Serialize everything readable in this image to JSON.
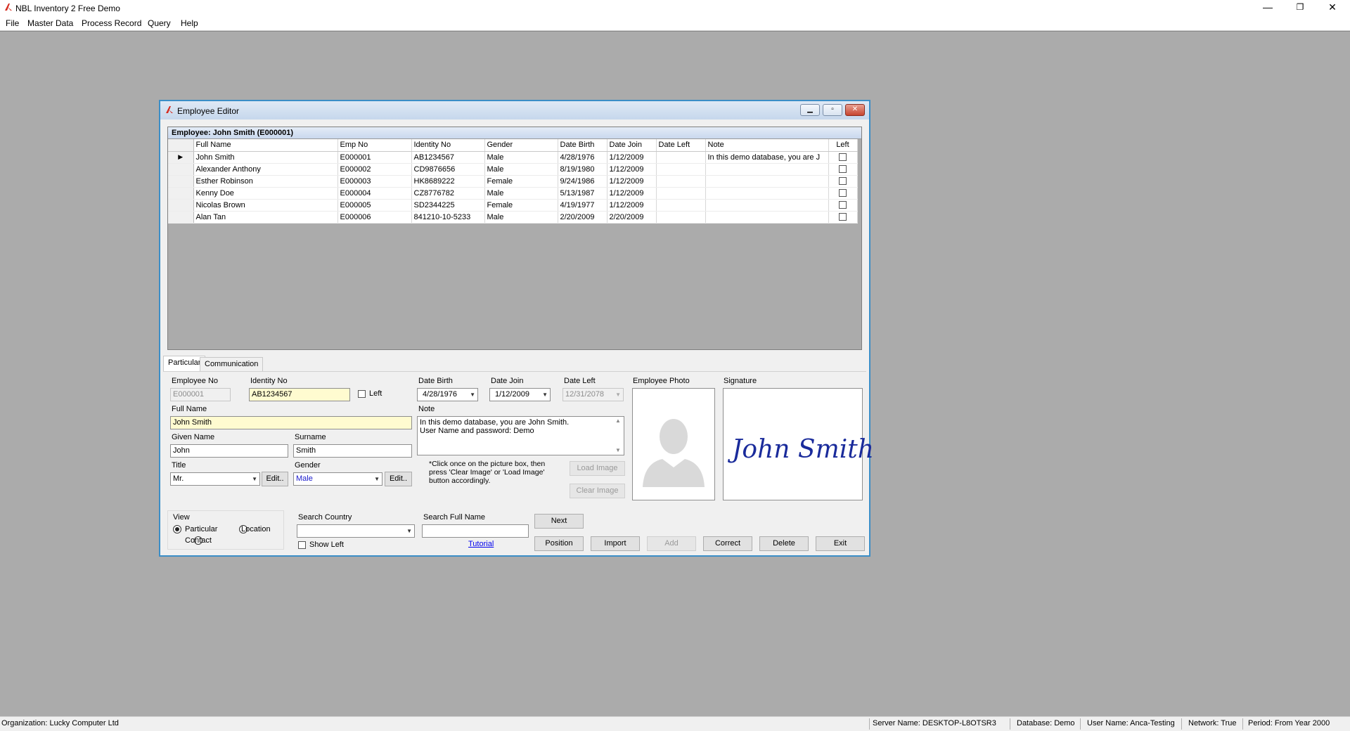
{
  "app": {
    "title": "NBL Inventory 2 Free Demo",
    "menu": [
      "File",
      "Master Data",
      "Process Record",
      "Query",
      "Help"
    ],
    "window_buttons": [
      "—",
      "❐",
      "✕"
    ]
  },
  "child": {
    "title": "Employee Editor",
    "grid_caption": "Employee: John Smith (E000001)",
    "columns": [
      "Full Name",
      "Emp No",
      "Identity No",
      "Gender",
      "Date Birth",
      "Date Join",
      "Date Left",
      "Note",
      "Left"
    ],
    "rows": [
      {
        "full_name": "John Smith",
        "emp_no": "E000001",
        "identity_no": "AB1234567",
        "gender": "Male",
        "date_birth": "4/28/1976",
        "date_join": "1/12/2009",
        "date_left": "",
        "note": "In this demo database, you are J",
        "current": "▶"
      },
      {
        "full_name": "Alexander Anthony",
        "emp_no": "E000002",
        "identity_no": "CD9876656",
        "gender": "Male",
        "date_birth": "8/19/1980",
        "date_join": "1/12/2009",
        "date_left": "",
        "note": "",
        "current": ""
      },
      {
        "full_name": "Esther Robinson",
        "emp_no": "E000003",
        "identity_no": "HK8689222",
        "gender": "Female",
        "date_birth": "9/24/1986",
        "date_join": "1/12/2009",
        "date_left": "",
        "note": "",
        "current": ""
      },
      {
        "full_name": "Kenny Doe",
        "emp_no": "E000004",
        "identity_no": "CZ8776782",
        "gender": "Male",
        "date_birth": "5/13/1987",
        "date_join": "1/12/2009",
        "date_left": "",
        "note": "",
        "current": ""
      },
      {
        "full_name": "Nicolas Brown",
        "emp_no": "E000005",
        "identity_no": "SD2344225",
        "gender": "Female",
        "date_birth": "4/19/1977",
        "date_join": "1/12/2009",
        "date_left": "",
        "note": "",
        "current": ""
      },
      {
        "full_name": "Alan Tan",
        "emp_no": "E000006",
        "identity_no": "841210-10-5233",
        "gender": "Male",
        "date_birth": "2/20/2009",
        "date_join": "2/20/2009",
        "date_left": "",
        "note": "",
        "current": ""
      }
    ],
    "tabs": [
      "Particular",
      "Communication"
    ],
    "form": {
      "employee_no_label": "Employee No",
      "employee_no": "E000001",
      "identity_no_label": "Identity No",
      "identity_no": "AB1234567",
      "left_label": "Left",
      "date_birth_label": "Date Birth",
      "date_birth": "4/28/1976",
      "date_join_label": "Date Join",
      "date_join": "1/12/2009",
      "date_left_label": "Date Left",
      "date_left": "12/31/2078",
      "employee_photo_label": "Employee Photo",
      "signature_label": "Signature",
      "signature_text": "John Smith",
      "full_name_label": "Full Name",
      "full_name": "John Smith",
      "note_label": "Note",
      "note": "In this demo database, you are John Smith.\nUser Name and password: Demo",
      "given_name_label": "Given Name",
      "given_name": "John",
      "surname_label": "Surname",
      "surname": "Smith",
      "title_label": "Title",
      "title": "Mr.",
      "gender_label": "Gender",
      "gender": "Male",
      "edit_label": "Edit..",
      "hint": "*Click once on the picture box, then press 'Clear Image' or 'Load Image' button accordingly.",
      "load_image": "Load Image",
      "clear_image": "Clear Image"
    },
    "bottom": {
      "view_label": "View",
      "view_particular": "Particular",
      "view_location": "Location",
      "view_contact": "Contact",
      "search_country_label": "Search Country",
      "search_country": "",
      "show_left_label": "Show Left",
      "search_full_name_label": "Search Full Name",
      "search_full_name": "",
      "tutorial": "Tutorial",
      "next": "Next",
      "position": "Position",
      "import": "Import",
      "add": "Add",
      "correct": "Correct",
      "delete": "Delete",
      "exit": "Exit"
    }
  },
  "status": {
    "organization": "Organization: Lucky Computer Ltd",
    "server": "Server Name: DESKTOP-L8OTSR3",
    "database": "Database: Demo",
    "user": "User Name: Anca-Testing",
    "network": "Network: True",
    "period": "Period: From Year 2000"
  }
}
